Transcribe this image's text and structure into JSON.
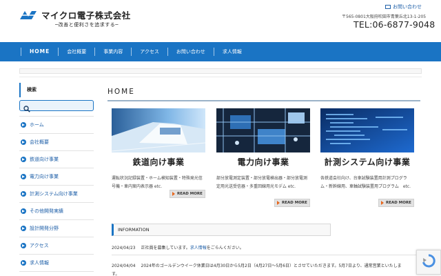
{
  "header": {
    "company_name": "マイクロ電子株式会社",
    "tagline": "─改善と便利さを追求する─",
    "contact_link": "お問い合わせ",
    "address": "〒565-0801大阪府吹田市青葉丘北13-1-205",
    "tel": "TEL:06-6877-9048"
  },
  "nav": {
    "items": [
      {
        "label": "HOME"
      },
      {
        "label": "会社概要"
      },
      {
        "label": "事業内容"
      },
      {
        "label": "アクセス"
      },
      {
        "label": "お問い合わせ"
      },
      {
        "label": "求人情報"
      }
    ]
  },
  "sidebar": {
    "search_title": "検索",
    "search_placeholder": "",
    "items": [
      {
        "label": "ホーム"
      },
      {
        "label": "会社概要"
      },
      {
        "label": "鉄道向け事業"
      },
      {
        "label": "電力向け事業"
      },
      {
        "label": "計測システム向け事業"
      },
      {
        "label": "その他開発実績"
      },
      {
        "label": "設計開発分野"
      },
      {
        "label": "アクセス"
      },
      {
        "label": "求人情報"
      }
    ]
  },
  "main": {
    "title": "HOME",
    "cards": [
      {
        "title": "鉄道向け事業",
        "desc": "運転状況記録装置・ホーム検知装置・特殊発光信号機・車内案内表示器 etc.",
        "more": "READ MORE"
      },
      {
        "title": "電力向け事業",
        "desc": "部分放電測定装置・部分放電検出器・部分放電測定用光送受信器・多重回線用光モデム etc.",
        "more": "READ MORE"
      },
      {
        "title": "計測システム向け事業",
        "desc": "各鉄道会社向け、台車試験装置用計測プログラム・新幹線用、車軸試験装置用プログラム　etc.",
        "more": "READ MORE"
      }
    ],
    "info_title": "INFORMATION",
    "news": [
      {
        "date": "2024/04/23",
        "text": "正社員を募集しています。",
        "link": "求人情報",
        "suffix": "をごらんください。"
      },
      {
        "date": "2024/04/04",
        "text": "2024年のゴールデンウイーク休業日は4月30日から5月2日（4月27日～5月6日）とさせていただきます。5月7日より、通常営業といたしま",
        "link": "",
        "suffix": ""
      },
      {
        "date": "",
        "text": "す。",
        "link": "",
        "suffix": ""
      }
    ]
  },
  "colors": {
    "accent": "#1a74c4",
    "link": "#1e5fa8",
    "more_arrow": "#e8661c"
  },
  "icons": [
    "mail-icon",
    "search-icon",
    "arrow-circle-icon",
    "recaptcha-icon"
  ]
}
